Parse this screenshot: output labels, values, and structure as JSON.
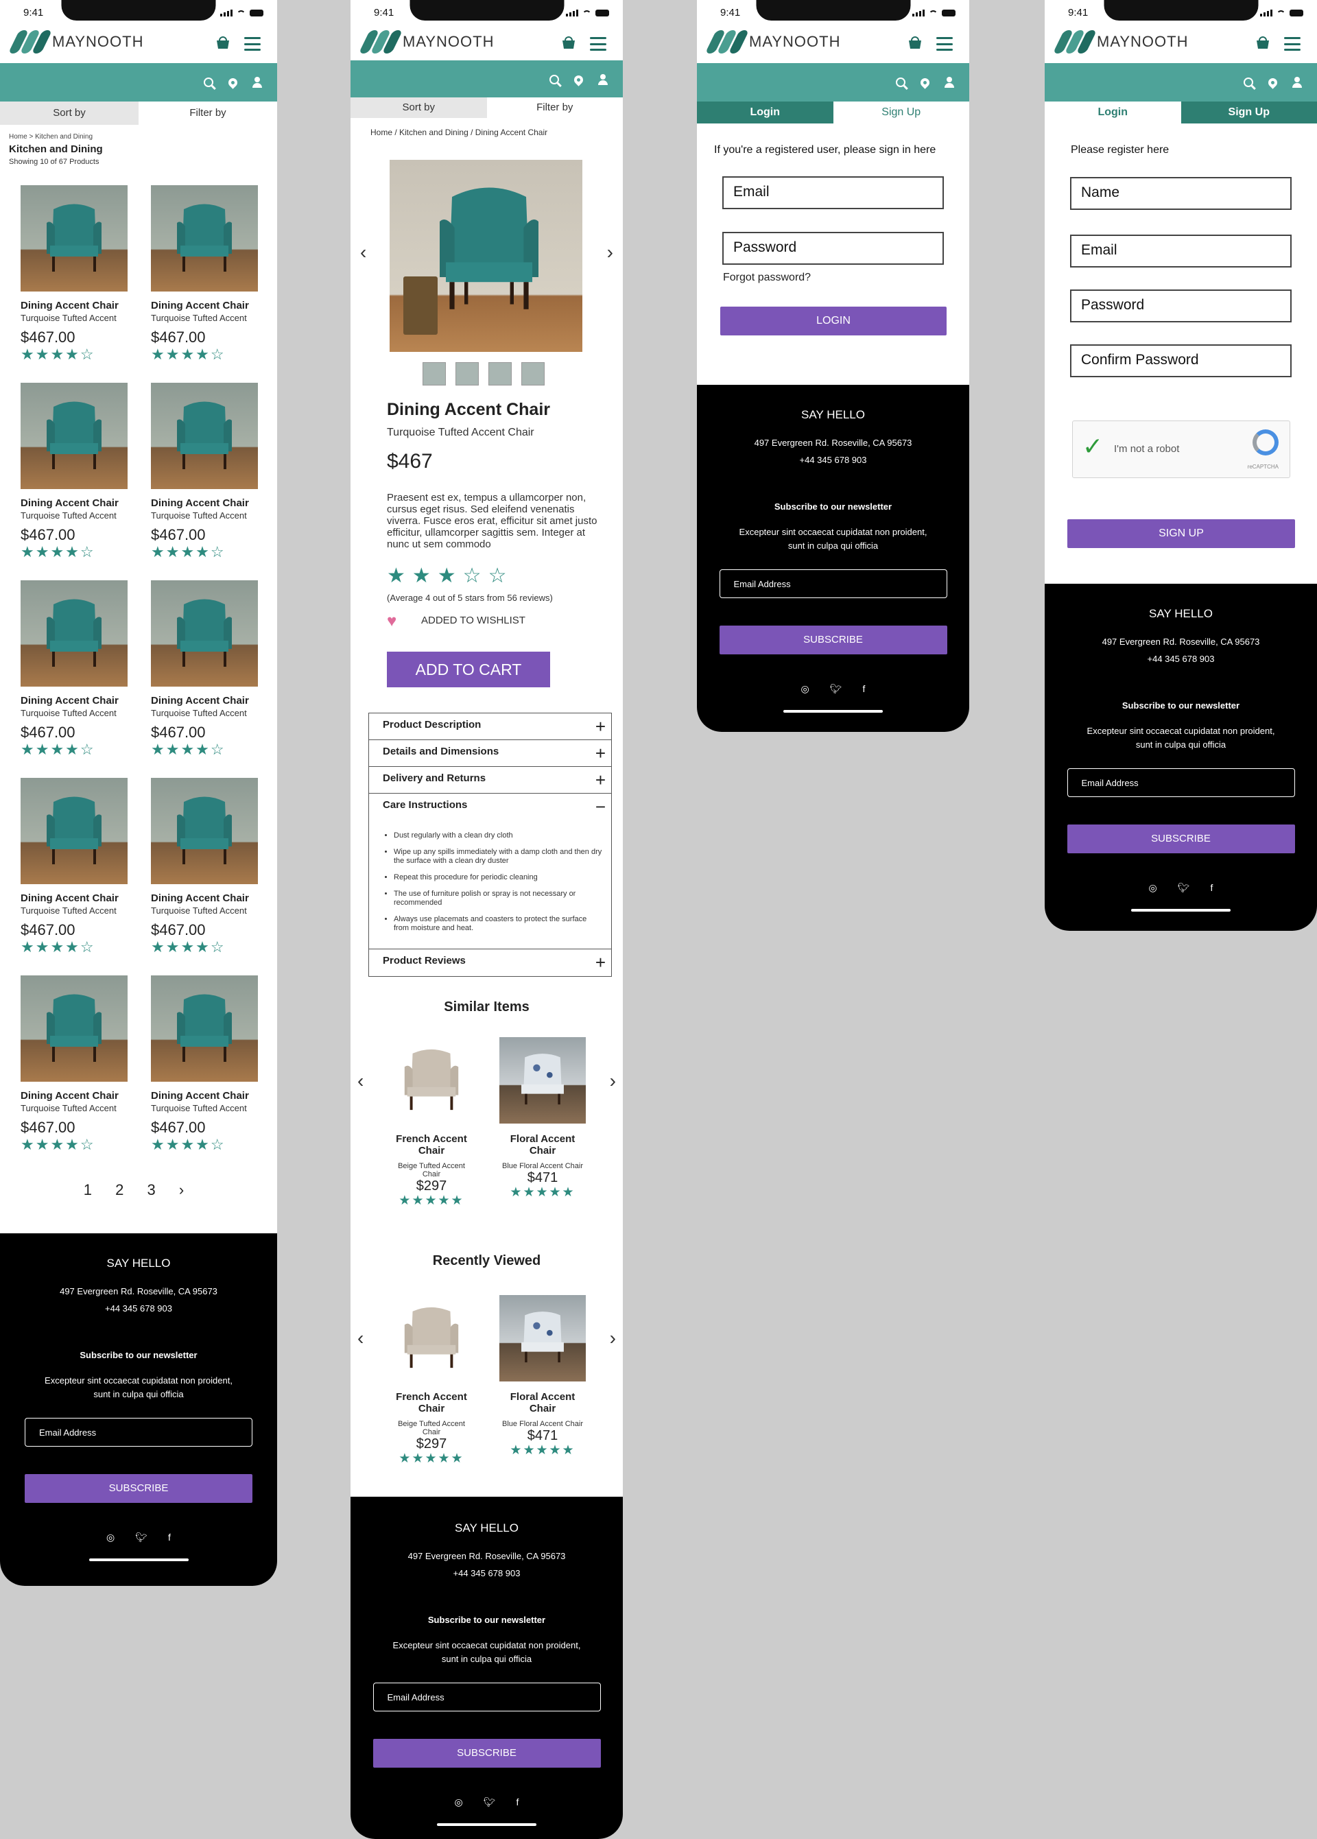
{
  "status": {
    "time": "9:41"
  },
  "brand": {
    "name": "MAYNOOTH",
    "teal": "#4ea399",
    "dark_teal": "#2e7f72",
    "purple": "#7b55b7"
  },
  "listing": {
    "tabs": [
      "Sort by",
      "Filter by"
    ],
    "breadcrumb": "Home > Kitchen and Dining",
    "title": "Kitchen and Dining",
    "count": "Showing 10 of 67 Products",
    "products": [
      {
        "name": "Dining Accent Chair",
        "sub": "Turquoise Tufted Accent",
        "price": "$467.00",
        "stars": "★★★★☆",
        "rating": 4
      },
      {
        "name": "Dining Accent Chair",
        "sub": "Turquoise Tufted Accent",
        "price": "$467.00",
        "stars": "★★★★☆",
        "rating": 4
      },
      {
        "name": "Dining Accent Chair",
        "sub": "Turquoise Tufted Accent",
        "price": "$467.00",
        "stars": "★★★★☆",
        "rating": 4
      },
      {
        "name": "Dining Accent Chair",
        "sub": "Turquoise Tufted Accent",
        "price": "$467.00",
        "stars": "★★★★☆",
        "rating": 4
      },
      {
        "name": "Dining Accent Chair",
        "sub": "Turquoise Tufted Accent",
        "price": "$467.00",
        "stars": "★★★★☆",
        "rating": 4
      },
      {
        "name": "Dining Accent Chair",
        "sub": "Turquoise Tufted Accent",
        "price": "$467.00",
        "stars": "★★★★☆",
        "rating": 4
      },
      {
        "name": "Dining Accent Chair",
        "sub": "Turquoise Tufted Accent",
        "price": "$467.00",
        "stars": "★★★★☆",
        "rating": 4
      },
      {
        "name": "Dining Accent Chair",
        "sub": "Turquoise Tufted Accent",
        "price": "$467.00",
        "stars": "★★★★☆",
        "rating": 4
      },
      {
        "name": "Dining Accent Chair",
        "sub": "Turquoise Tufted Accent",
        "price": "$467.00",
        "stars": "★★★★☆",
        "rating": 4
      },
      {
        "name": "Dining Accent Chair",
        "sub": "Turquoise Tufted Accent",
        "price": "$467.00",
        "stars": "★★★★☆",
        "rating": 4
      }
    ],
    "pager": [
      "1",
      "2",
      "3",
      "›"
    ]
  },
  "detail": {
    "tabs": [
      "Sort by",
      "Filter by"
    ],
    "breadcrumb": "Home / Kitchen and Dining / Dining Accent Chair",
    "prev": "‹",
    "next": "›",
    "name": "Dining Accent Chair",
    "sub": "Turquoise Tufted Accent Chair",
    "price": "$467",
    "description": "Praesent est ex, tempus a ullamcorper non, cursus eget risus. Sed eleifend venenatis viverra. Fusce eros erat, efficitur sit amet justo efficitur, ullamcorper sagittis sem. Integer at nunc ut sem commodo",
    "stars": "★★★☆☆",
    "rating": 3,
    "average": "(Average 4 out of 5 stars from 56 reviews)",
    "wishlist": "ADDED TO WISHLIST",
    "add_to_cart": "ADD TO CART",
    "accordion": [
      {
        "title": "Product Description",
        "icon": "+"
      },
      {
        "title": "Details and Dimensions",
        "icon": "+"
      },
      {
        "title": "Delivery and Returns",
        "icon": "+"
      },
      {
        "title": "Care Instructions",
        "icon": "−"
      }
    ],
    "care": [
      "Dust regularly with a clean dry cloth",
      "Wipe up any spills immediately with a damp cloth and then dry the surface with a clean dry duster",
      "Repeat this procedure for periodic cleaning",
      "The use of furniture polish or spray is not necessary or recommended",
      "Always use placemats and coasters to protect the surface from moisture and heat."
    ],
    "reviews": {
      "title": "Product Reviews",
      "icon": "+"
    },
    "similar_title": "Similar Items",
    "recent_title": "Recently Viewed",
    "similar": [
      {
        "name": "French Accent Chair",
        "sub": "Beige Tufted Accent Chair",
        "price": "$297",
        "stars": "★★★★★",
        "rating": 5
      },
      {
        "name": "Floral Accent Chair",
        "sub": "Blue Floral Accent Chair",
        "price": "$471",
        "stars": "★★★★★",
        "rating": 5
      }
    ],
    "recent": [
      {
        "name": "French Accent Chair",
        "sub": "Beige Tufted Accent Chair",
        "price": "$297",
        "stars": "★★★★★",
        "rating": 5
      },
      {
        "name": "Floral Accent Chair",
        "sub": "Blue Floral Accent Chair",
        "price": "$471",
        "stars": "★★★★★",
        "rating": 5
      }
    ]
  },
  "login": {
    "tab_login": "Login",
    "tab_signup": "Sign Up",
    "intro": "If you're a registered user, please sign in here",
    "email_placeholder": "Email",
    "password_placeholder": "Password",
    "forgot": "Forgot password?",
    "button": "LOGIN"
  },
  "signup": {
    "tab_login": "Login",
    "tab_signup": "Sign Up",
    "intro": "Please register here",
    "name_placeholder": "Name",
    "email_placeholder": "Email",
    "password_placeholder": "Password",
    "confirm_placeholder": "Confirm Password",
    "captcha_label": "I'm not a robot",
    "captcha_brand": "reCAPTCHA",
    "button": "SIGN UP"
  },
  "footer": {
    "say_hello": "SAY HELLO",
    "address": "497 Evergreen Rd. Roseville, CA 95673",
    "phone": "+44 345 678 903",
    "newsletter_title": "Subscribe to our newsletter",
    "newsletter_text_1": "Excepteur sint occaecat cupidatat non proident,",
    "newsletter_text_2": "sunt in culpa qui officia",
    "email_placeholder": "Email Address",
    "subscribe": "SUBSCRIBE",
    "social": [
      "instagram-icon",
      "twitter-icon",
      "facebook-icon"
    ]
  }
}
